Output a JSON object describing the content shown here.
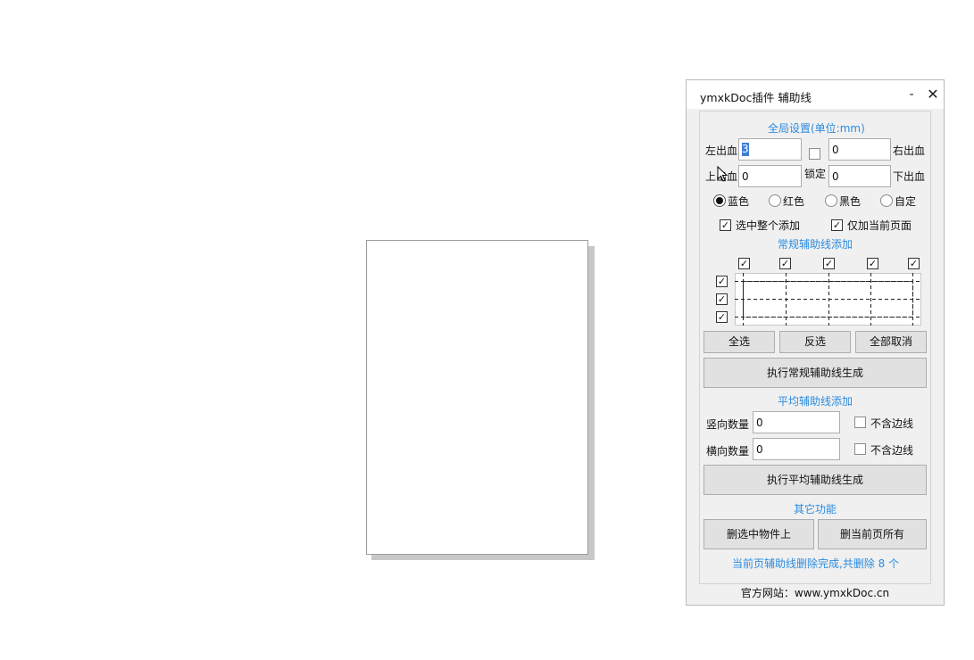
{
  "window": {
    "title": "ymxkDoc插件  辅助线",
    "minimize_label": "-",
    "close_label": "✕"
  },
  "global": {
    "section_title": "全局设置(单位:mm)",
    "left_bleed_label": "左出血",
    "left_bleed_value": "3",
    "right_bleed_label": "右出血",
    "right_bleed_value": "0",
    "top_bleed_label": "上出血",
    "top_bleed_value": "0",
    "bottom_bleed_label": "下出血",
    "bottom_bleed_value": "0",
    "lock_label": "锁定",
    "colors": [
      {
        "label": "蓝色",
        "selected": true
      },
      {
        "label": "红色",
        "selected": false
      },
      {
        "label": "黑色",
        "selected": false
      },
      {
        "label": "自定",
        "selected": false
      }
    ],
    "select_whole_add_label": "选中整个添加",
    "current_page_only_label": "仅加当前页面"
  },
  "regular": {
    "section_title": "常规辅助线添加",
    "select_all": "全选",
    "invert": "反选",
    "deselect_all": "全部取消",
    "execute": "执行常规辅助线生成"
  },
  "average": {
    "section_title": "平均辅助线添加",
    "vertical_label": "竖向数量",
    "vertical_value": "0",
    "horizontal_label": "横向数量",
    "horizontal_value": "0",
    "exclude_edge_label": "不含边线",
    "execute": "执行平均辅助线生成"
  },
  "other": {
    "section_title": "其它功能",
    "delete_selected": "删选中物件上",
    "delete_page_all": "删当前页所有",
    "status": "当前页辅助线删除完成,共删除 8 个"
  },
  "footer": "官方网站：www.ymxkDoc.cn",
  "check_mark": "✓",
  "accent_color": "#2b8ce0"
}
